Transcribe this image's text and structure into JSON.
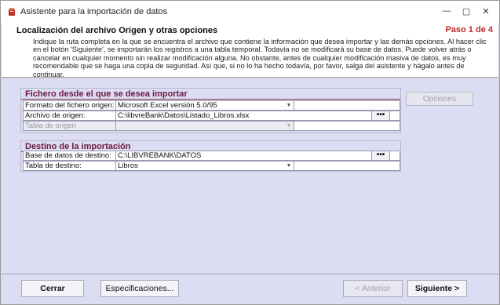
{
  "window": {
    "title": "Asistente para la importación de datos",
    "minimize_glyph": "—",
    "maximize_glyph": "▢",
    "close_glyph": "✕"
  },
  "header": {
    "title": "Localización del archivo Origen y otras opciones",
    "step": "Paso 1 de 4",
    "description": "Indique la ruta completa en la que se encuentra el archivo que contiene la información que desea importar y las demás opciones. Al hacer clic en el botón 'Siguiente', se importarán los registros a una tabla temporal. Todavía no se modificará su base de datos. Puede volver atrás o cancelar en cualquier momento sin realizar modificación alguna. No obstante, antes de cualquier modificación masiva de datos, es muy recomendable que se haga una copia de seguridad. Así que, si no lo ha hecho todavía, por favor, salga del asistente y hágalo antes de continuar."
  },
  "source_group": {
    "title": "Fichero desde el que se desea importar",
    "format_label": "Formato del fichero origen:",
    "format_value": "Microsoft Excel versión 5.0/95",
    "file_label": "Archivo de origen:",
    "file_value": "C:\\libvreBank\\Datos\\Listado_Libros.xlsx",
    "table_label": "Tabla de origen",
    "table_value": "",
    "browse_label": "•••"
  },
  "dest_group": {
    "title": "Destino de la importación",
    "db_label": "Base de datos de destino:",
    "db_value": "C:\\LIBVREBANK\\DATOS",
    "table_label": "Tabla de destino:",
    "table_value": "Libros",
    "browse_label": "•••"
  },
  "options_button": "Opciones",
  "footer": {
    "close": "Cerrar",
    "specs": "Especificaciones...",
    "back": "< Anterior",
    "next": "Siguiente >"
  },
  "colors": {
    "step": "#c0282a",
    "group_title": "#6b1a3e",
    "background": "#dcdcf2"
  }
}
